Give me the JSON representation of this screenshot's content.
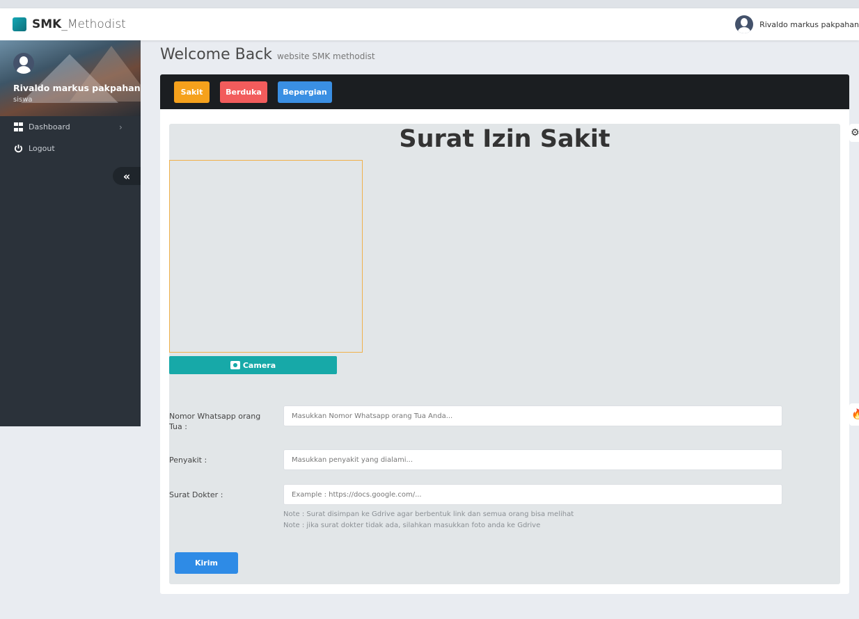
{
  "header": {
    "brand_bold": "SMK",
    "brand_light": " _Methodist",
    "user_name": "Rivaldo markus pakpahan"
  },
  "sidebar": {
    "profile_name": "Rivaldo markus pakpahan",
    "profile_role": "siswa",
    "items": [
      {
        "label": "Dashboard",
        "icon": "dashboard-grid-icon"
      },
      {
        "label": "Logout",
        "icon": "power-icon"
      }
    ],
    "collapse_icon": "«"
  },
  "page": {
    "welcome": "Welcome Back",
    "welcome_sub": "website SMK methodist"
  },
  "tabs": [
    {
      "label": "Sakit",
      "color": "#f5a11c"
    },
    {
      "label": "Berduka",
      "color": "#f25c5c"
    },
    {
      "label": "Bepergian",
      "color": "#3a8fe3"
    }
  ],
  "form": {
    "title": "Surat Izin Sakit",
    "camera_label": "Camera",
    "fields": [
      {
        "label": "Nomor Whatsapp orang Tua :",
        "placeholder": "Masukkan Nomor Whatsapp orang Tua Anda..."
      },
      {
        "label": "Penyakit :",
        "placeholder": "Masukkan penyakit yang dialami..."
      },
      {
        "label": "Surat Dokter :",
        "placeholder": "Example : https://docs.google.com/..."
      }
    ],
    "notes": [
      "Note : Surat disimpan ke Gdrive agar berbentuk link dan semua orang bisa melihat",
      "Note : jika surat dokter tidak ada, silahkan masukkan foto anda ke Gdrive"
    ],
    "submit_label": "Kirim"
  },
  "colors": {
    "accent_teal": "#17a9a8",
    "primary_blue": "#2e8be6",
    "sidebar_bg": "#2b323a"
  }
}
